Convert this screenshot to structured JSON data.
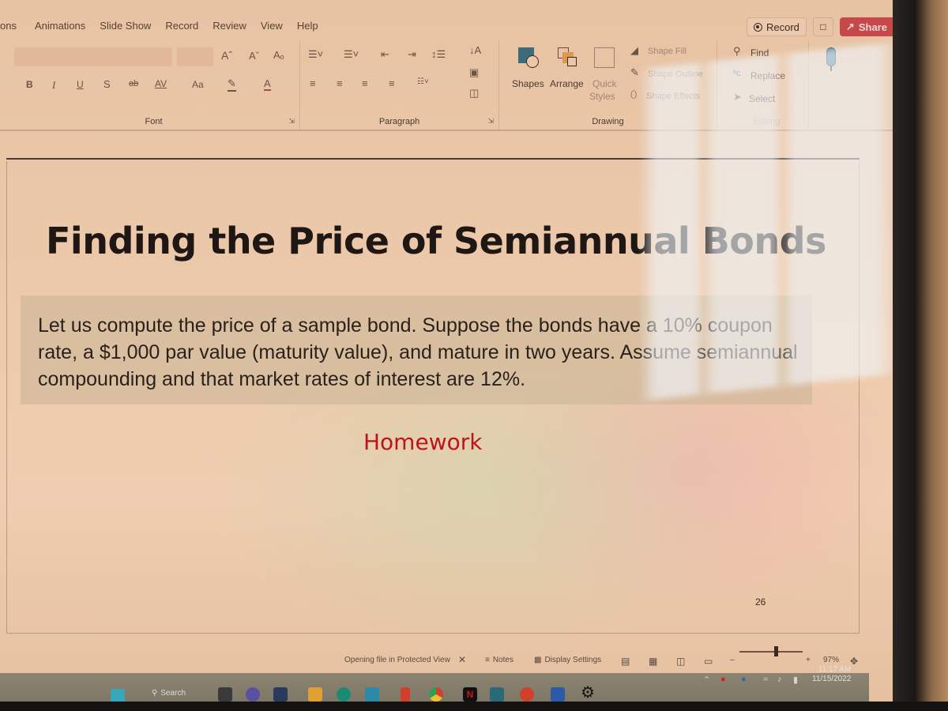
{
  "menu": {
    "tabs": [
      "ons",
      "Animations",
      "Slide Show",
      "Record",
      "Review",
      "View",
      "Help"
    ]
  },
  "header_actions": {
    "record_label": "Record",
    "comment_icon": "comment-icon",
    "share_label": "Share",
    "share_color": "#c6484a"
  },
  "ribbon": {
    "font_group": {
      "label": "Font",
      "font_name_value": "",
      "font_size_value": "",
      "buttons": {
        "increase_font": "Aˆ",
        "decrease_font": "Aˇ",
        "clear_format": "Aₒ",
        "bold": "B",
        "italic": "I",
        "underline": "U",
        "shadow": "S",
        "strike": "ab",
        "spacing": "AV",
        "case": "Aa",
        "highlight": "✎",
        "font_color": "A"
      }
    },
    "paragraph_group": {
      "label": "Paragraph"
    },
    "drawing_group": {
      "label": "Drawing",
      "shapes_label": "Shapes",
      "arrange_label": "Arrange",
      "quick_styles_label": "Quick",
      "quick_styles_label2": "Styles",
      "shape_fill_label": "Shape Fill",
      "shape_outline_label": "Shape Outline",
      "shape_effects_label": "Shape Effects"
    },
    "editing_group": {
      "label": "Editing",
      "find_label": "Find",
      "replace_label": "Replace",
      "select_label": "Select"
    },
    "voice_group": {
      "label": "Voice"
    }
  },
  "slide": {
    "title": "Finding the Price of Semiannual Bonds",
    "body": "Let us compute the price of a sample bond. Suppose the bonds have a 10% coupon rate, a $1,000 par value (maturity value), and mature in two years. Assume semiannual compounding and that market rates of interest are 12%.",
    "subtitle": "Homework",
    "subtitle_color": "#c0121a",
    "slide_number": "26"
  },
  "statusbar": {
    "protected_view": "Opening file in Protected View",
    "close_icon": "✕",
    "notes_label": "Notes",
    "display_settings_label": "Display Settings",
    "zoom_minus": "–",
    "zoom_plus": "+",
    "zoom_level": "97%",
    "zoom_fraction": 0.58
  },
  "taskbar": {
    "search_label": "Search",
    "time": "11:17 AM",
    "date": "11/15/2022"
  }
}
